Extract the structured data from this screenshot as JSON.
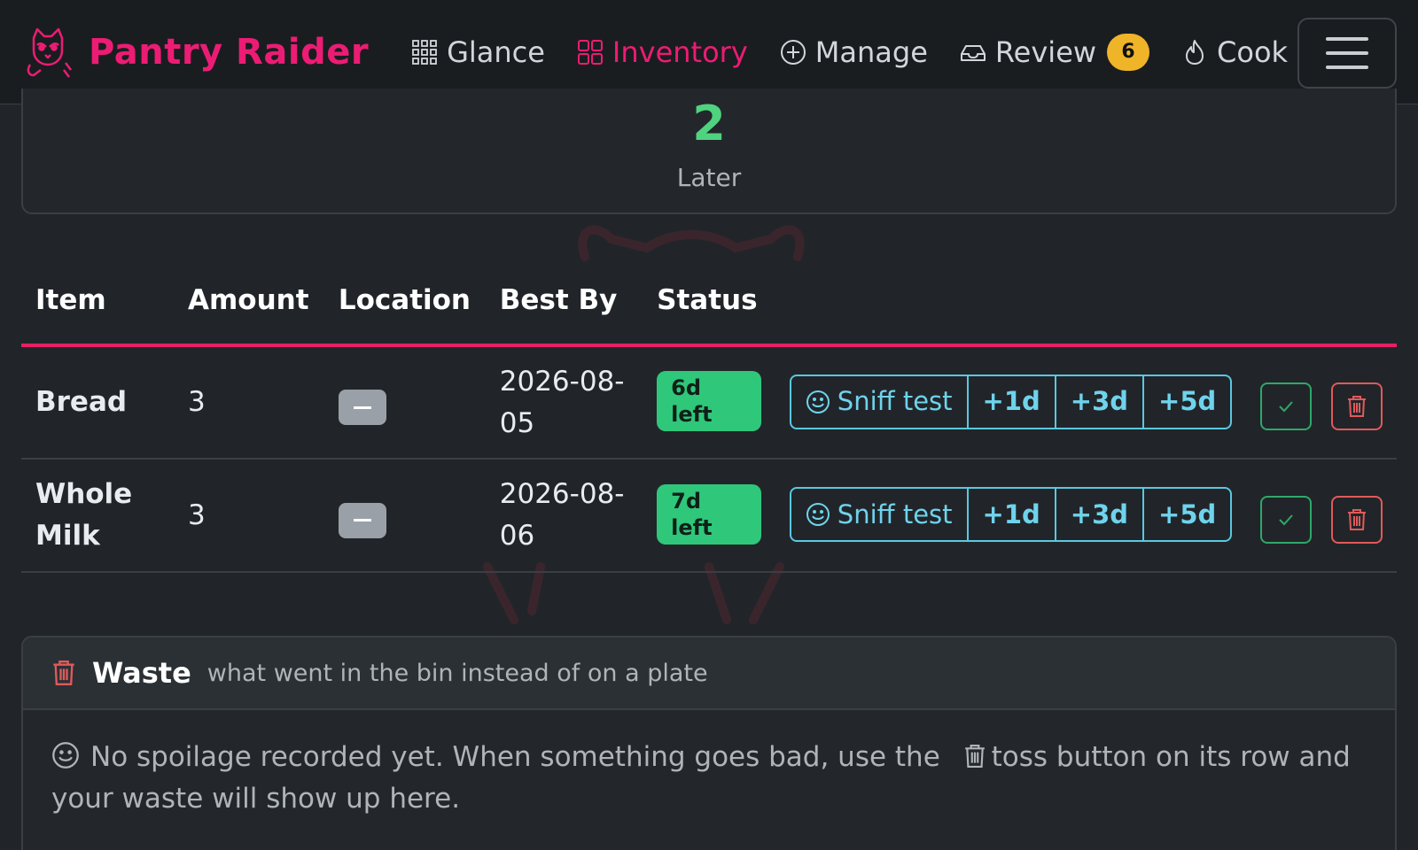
{
  "nav": {
    "brand": "Pantry Raider",
    "items": [
      {
        "label": "Glance",
        "icon": "grid-icon"
      },
      {
        "label": "Inventory",
        "icon": "apps-icon",
        "active": true
      },
      {
        "label": "Manage",
        "icon": "plus-circle-icon"
      },
      {
        "label": "Review",
        "icon": "inbox-icon",
        "badge": "6"
      },
      {
        "label": "Cook",
        "icon": "fire-icon"
      }
    ],
    "accent": "#ec1c74",
    "badge_color": "#f0b429"
  },
  "stat": {
    "value": "2",
    "label": "Later",
    "color": "#4fd37f"
  },
  "table": {
    "headers": [
      "Item",
      "Amount",
      "Location",
      "Best By",
      "Status"
    ],
    "rows": [
      {
        "item": "Bread",
        "amount": "3",
        "location": "–",
        "best_by": "2026-08-05",
        "status": "6d left"
      },
      {
        "item": "Whole Milk",
        "amount": "3",
        "location": "–",
        "best_by": "2026-08-06",
        "status": "7d left"
      }
    ],
    "actions": {
      "sniff": "Sniff test",
      "plus1": "+1d",
      "plus3": "+3d",
      "plus5": "+5d"
    }
  },
  "waste": {
    "title": "Waste",
    "subtitle": "what went in the bin instead of on a plate",
    "empty_before": "No spoilage recorded yet. When something goes bad, use the",
    "empty_after": "toss button on its row and your waste will show up here."
  }
}
